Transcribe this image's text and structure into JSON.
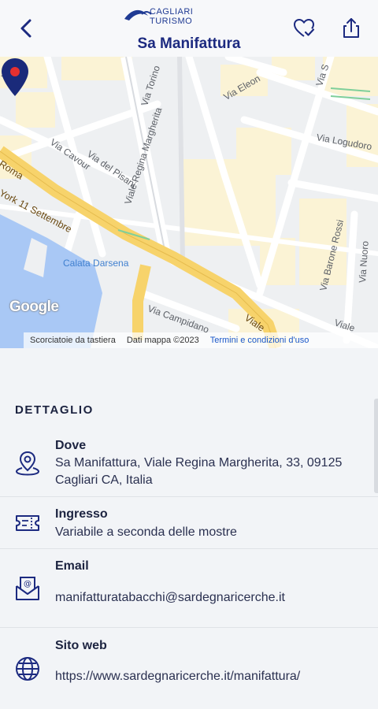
{
  "header": {
    "logo_line1": "CAGLIARI",
    "logo_line2": "TURISMO",
    "title": "Sa Manifattura",
    "back_icon": "chevron-left-icon",
    "favorite_icon": "heart-check-icon",
    "share_icon": "share-icon"
  },
  "map": {
    "street_labels": [
      "Via Torino",
      "Via Eleon",
      "Via S",
      "Via Logudoro",
      "Via Cavour",
      "Via del Pisani",
      "Viale Regina Margherita",
      "Roma",
      "York 11 Settembre",
      "Calata Darsena",
      "Via Barone Rossi",
      "Via Nuoro",
      "Via Campidano",
      "Viale",
      "Viale"
    ],
    "google_label": "Google",
    "footer": {
      "shortcuts": "Scorciatoie da tastiera",
      "data": "Dati mappa ©2023",
      "terms": "Termini e condizioni d'uso"
    },
    "colors": {
      "land": "#eef0f2",
      "block": "#fbf3d5",
      "main_road": "#f7d36b",
      "water": "#a9c8f5",
      "pin": "#1a2a7a"
    }
  },
  "details": {
    "section_title": "DETTAGLIO",
    "dove": {
      "label": "Dove",
      "value": "Sa Manifattura, Viale Regina Margherita, 33, 09125 Cagliari CA, Italia"
    },
    "ingresso": {
      "label": "Ingresso",
      "value": "Variabile a seconda delle mostre"
    },
    "email": {
      "label": "Email",
      "value": "manifatturatabacchi@sardegnaricerche.it"
    },
    "sito": {
      "label": "Sito web",
      "value": "https://www.sardegnaricerche.it/manifattura/"
    }
  },
  "colors": {
    "brand": "#1c2a80",
    "text": "#1c2340",
    "background": "#f2f4f7"
  }
}
